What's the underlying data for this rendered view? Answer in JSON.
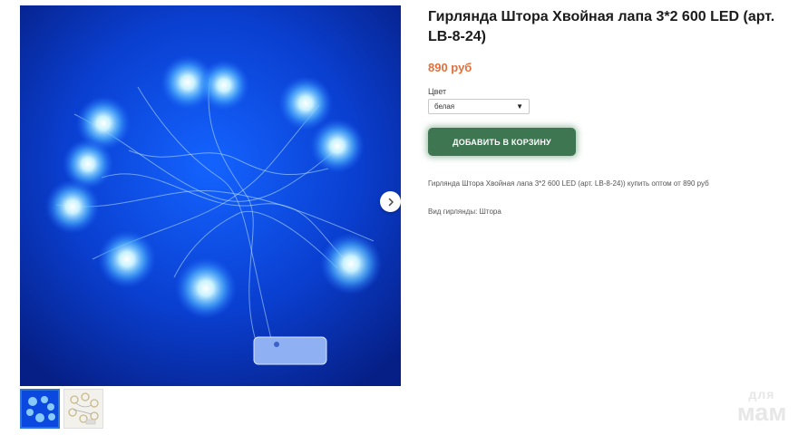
{
  "product": {
    "title": "Гирлянда Штора Хвойная лапа 3*2 600 LED (арт. LB-8-24)",
    "price": "890 руб",
    "color_label": "Цвет",
    "color_selected": "белая",
    "add_to_cart_label": "ДОБАВИТЬ В КОРЗИНУ",
    "description": "Гирлянда Штора Хвойная лапа 3*2 600 LED (арт. LB-8-24)) купить оптом от 890 руб",
    "garland_type": "Вид гирлянды: Штора"
  },
  "gallery": {
    "next_icon": "chevron-right-icon",
    "thumbnail_count": 2,
    "active_thumbnail": 1
  },
  "watermark": {
    "line1": "для",
    "line2": "мам"
  },
  "colors": {
    "price": "#e2703a",
    "cart_button": "#3e7652",
    "photo_background": "#0a3fd0",
    "led_glow": "#9fe2ff"
  }
}
